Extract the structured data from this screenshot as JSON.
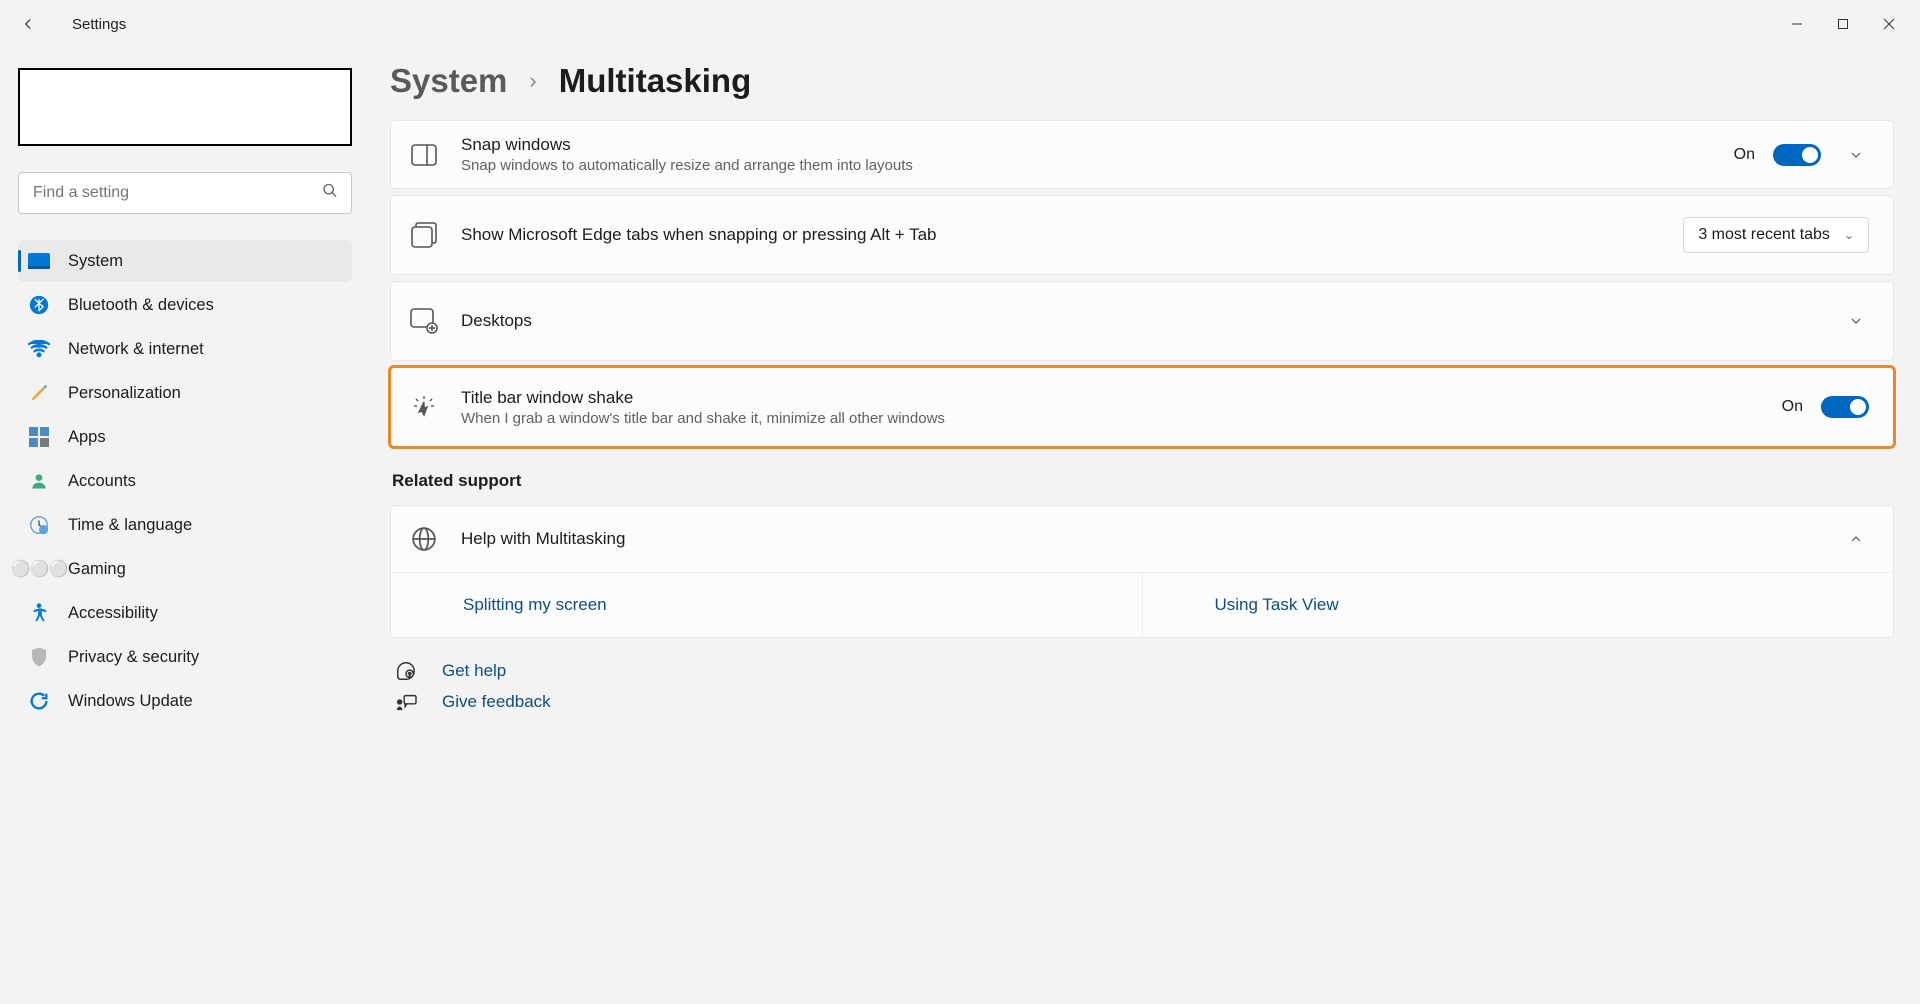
{
  "app_title": "Settings",
  "breadcrumb": {
    "parent": "System",
    "current": "Multitasking"
  },
  "search": {
    "placeholder": "Find a setting"
  },
  "sidebar": {
    "items": [
      {
        "label": "System",
        "active": true
      },
      {
        "label": "Bluetooth & devices"
      },
      {
        "label": "Network & internet"
      },
      {
        "label": "Personalization"
      },
      {
        "label": "Apps"
      },
      {
        "label": "Accounts"
      },
      {
        "label": "Time & language"
      },
      {
        "label": "Gaming"
      },
      {
        "label": "Accessibility"
      },
      {
        "label": "Privacy & security"
      },
      {
        "label": "Windows Update"
      }
    ]
  },
  "cards": {
    "snap": {
      "title": "Snap windows",
      "sub": "Snap windows to automatically resize and arrange them into layouts",
      "state": "On"
    },
    "edge": {
      "title": "Show Microsoft Edge tabs when snapping or pressing Alt + Tab",
      "dropdown": "3 most recent tabs"
    },
    "desktops": {
      "title": "Desktops"
    },
    "shake": {
      "title": "Title bar window shake",
      "sub": "When I grab a window's title bar and shake it, minimize all other windows",
      "state": "On"
    }
  },
  "related": {
    "heading": "Related support",
    "help_title": "Help with Multitasking",
    "link1": "Splitting my screen",
    "link2": "Using Task View"
  },
  "footer": {
    "get_help": "Get help",
    "feedback": "Give feedback"
  }
}
